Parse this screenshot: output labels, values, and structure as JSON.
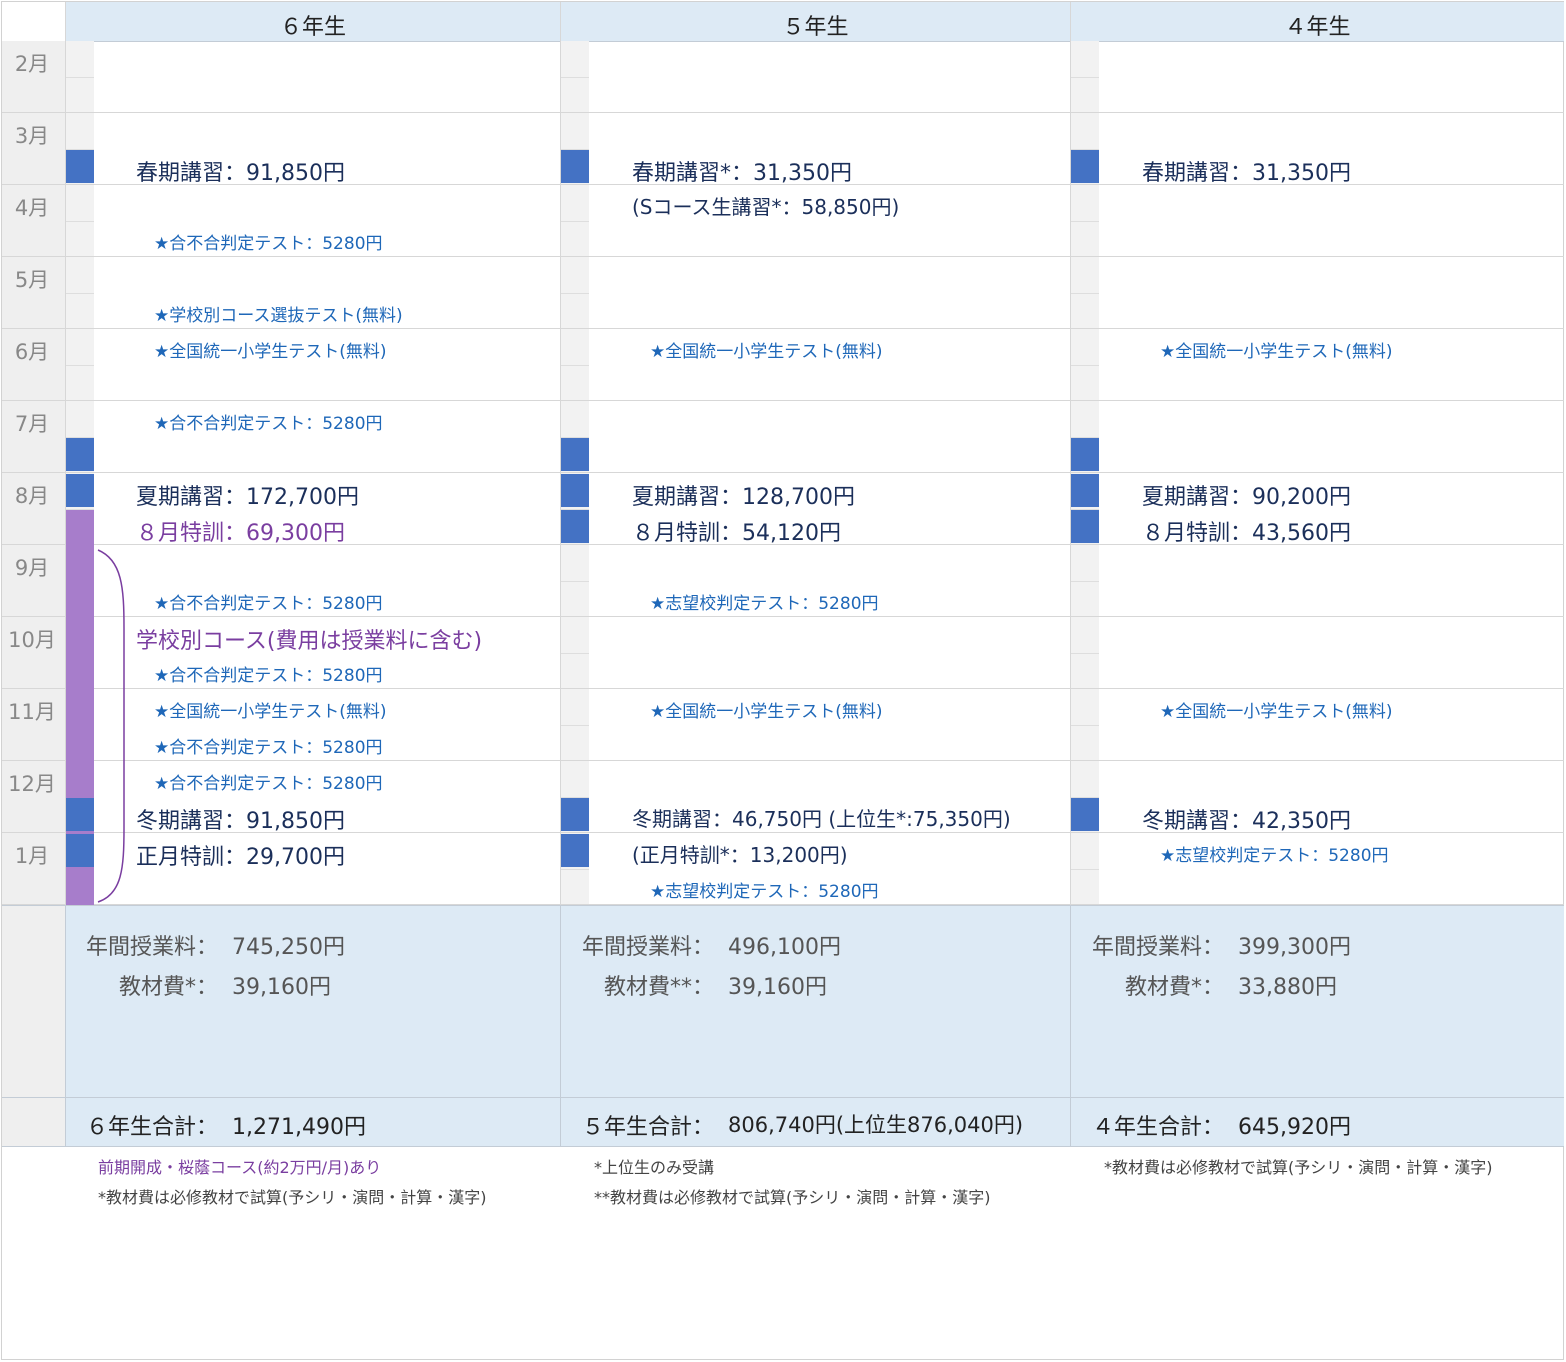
{
  "headers": [
    "６年生",
    "５年生",
    "４年生"
  ],
  "months": [
    "2月",
    "3月",
    "4月",
    "5月",
    "6月",
    "7月",
    "8月",
    "9月",
    "10月",
    "11月",
    "12月",
    "1月"
  ],
  "g6": {
    "spring": "春期講習：91,850円",
    "test_apr": "★合不合判定テスト：5280円",
    "test_may": "★学校別コース選抜テスト(無料)",
    "test_jun": "★全国統一小学生テスト(無料)",
    "test_jul": "★合不合判定テスト：5280円",
    "summer": "夏期講習：172,700円",
    "aug_special": "８月特訓：69,300円",
    "test_sep": "★合不合判定テスト：5280円",
    "school_course": "学校別コース(費用は授業料に含む)",
    "test_oct": "★合不合判定テスト：5280円",
    "test_nov1": "★全国統一小学生テスト(無料)",
    "test_nov2": "★合不合判定テスト：5280円",
    "test_dec": "★合不合判定テスト：5280円",
    "winter": "冬期講習：91,850円",
    "new_year": "正月特訓：29,700円"
  },
  "g5": {
    "spring": "春期講習*：31,350円",
    "s_course": "(Sコース生講習*：58,850円)",
    "test_jun": "★全国統一小学生テスト(無料)",
    "summer": "夏期講習：128,700円",
    "aug_special": "８月特訓：54,120円",
    "test_sep": "★志望校判定テスト：5280円",
    "test_nov": "★全国統一小学生テスト(無料)",
    "winter": "冬期講習：46,750円 (上位生*:75,350円)",
    "new_year": "(正月特訓*：13,200円)",
    "test_jan": "★志望校判定テスト：5280円"
  },
  "g4": {
    "spring": "春期講習：31,350円",
    "test_jun": "★全国統一小学生テスト(無料)",
    "summer": "夏期講習：90,200円",
    "aug_special": "８月特訓：43,560円",
    "test_nov": "★全国統一小学生テスト(無料)",
    "winter": "冬期講習：42,350円",
    "test_jan": "★志望校判定テスト：5280円"
  },
  "summary": {
    "tuition_label": "年間授業料：",
    "g6_material_label": "教材費*：",
    "g5_material_label": "教材費**：",
    "g4_material_label": "教材費*：",
    "g6_tuition": "745,250円",
    "g6_material": "39,160円",
    "g5_tuition": "496,100円",
    "g5_material": "39,160円",
    "g4_tuition": "399,300円",
    "g4_material": "33,880円"
  },
  "totals": {
    "g6_label": "６年生合計：",
    "g6_value": "1,271,490円",
    "g5_label": "５年生合計：",
    "g5_value": "806,740円(上位生876,040円)",
    "g4_label": "４年生合計：",
    "g4_value": "645,920円"
  },
  "notes": {
    "g6_line1": "前期開成・桜蔭コース(約2万円/月)あり",
    "g6_line2": "*教材費は必修教材で試算(予シリ・演問・計算・漢字)",
    "g5_line1": "*上位生のみ受講",
    "g5_line2": "**教材費は必修教材で試算(予シリ・演問・計算・漢字)",
    "g4_line1": "*教材費は必修教材で試算(予シリ・演問・計算・漢字)"
  },
  "colors": {
    "session_bar": "#4472c4",
    "special_bar": "#a77dcb",
    "header_bg": "#ddeaf5"
  }
}
